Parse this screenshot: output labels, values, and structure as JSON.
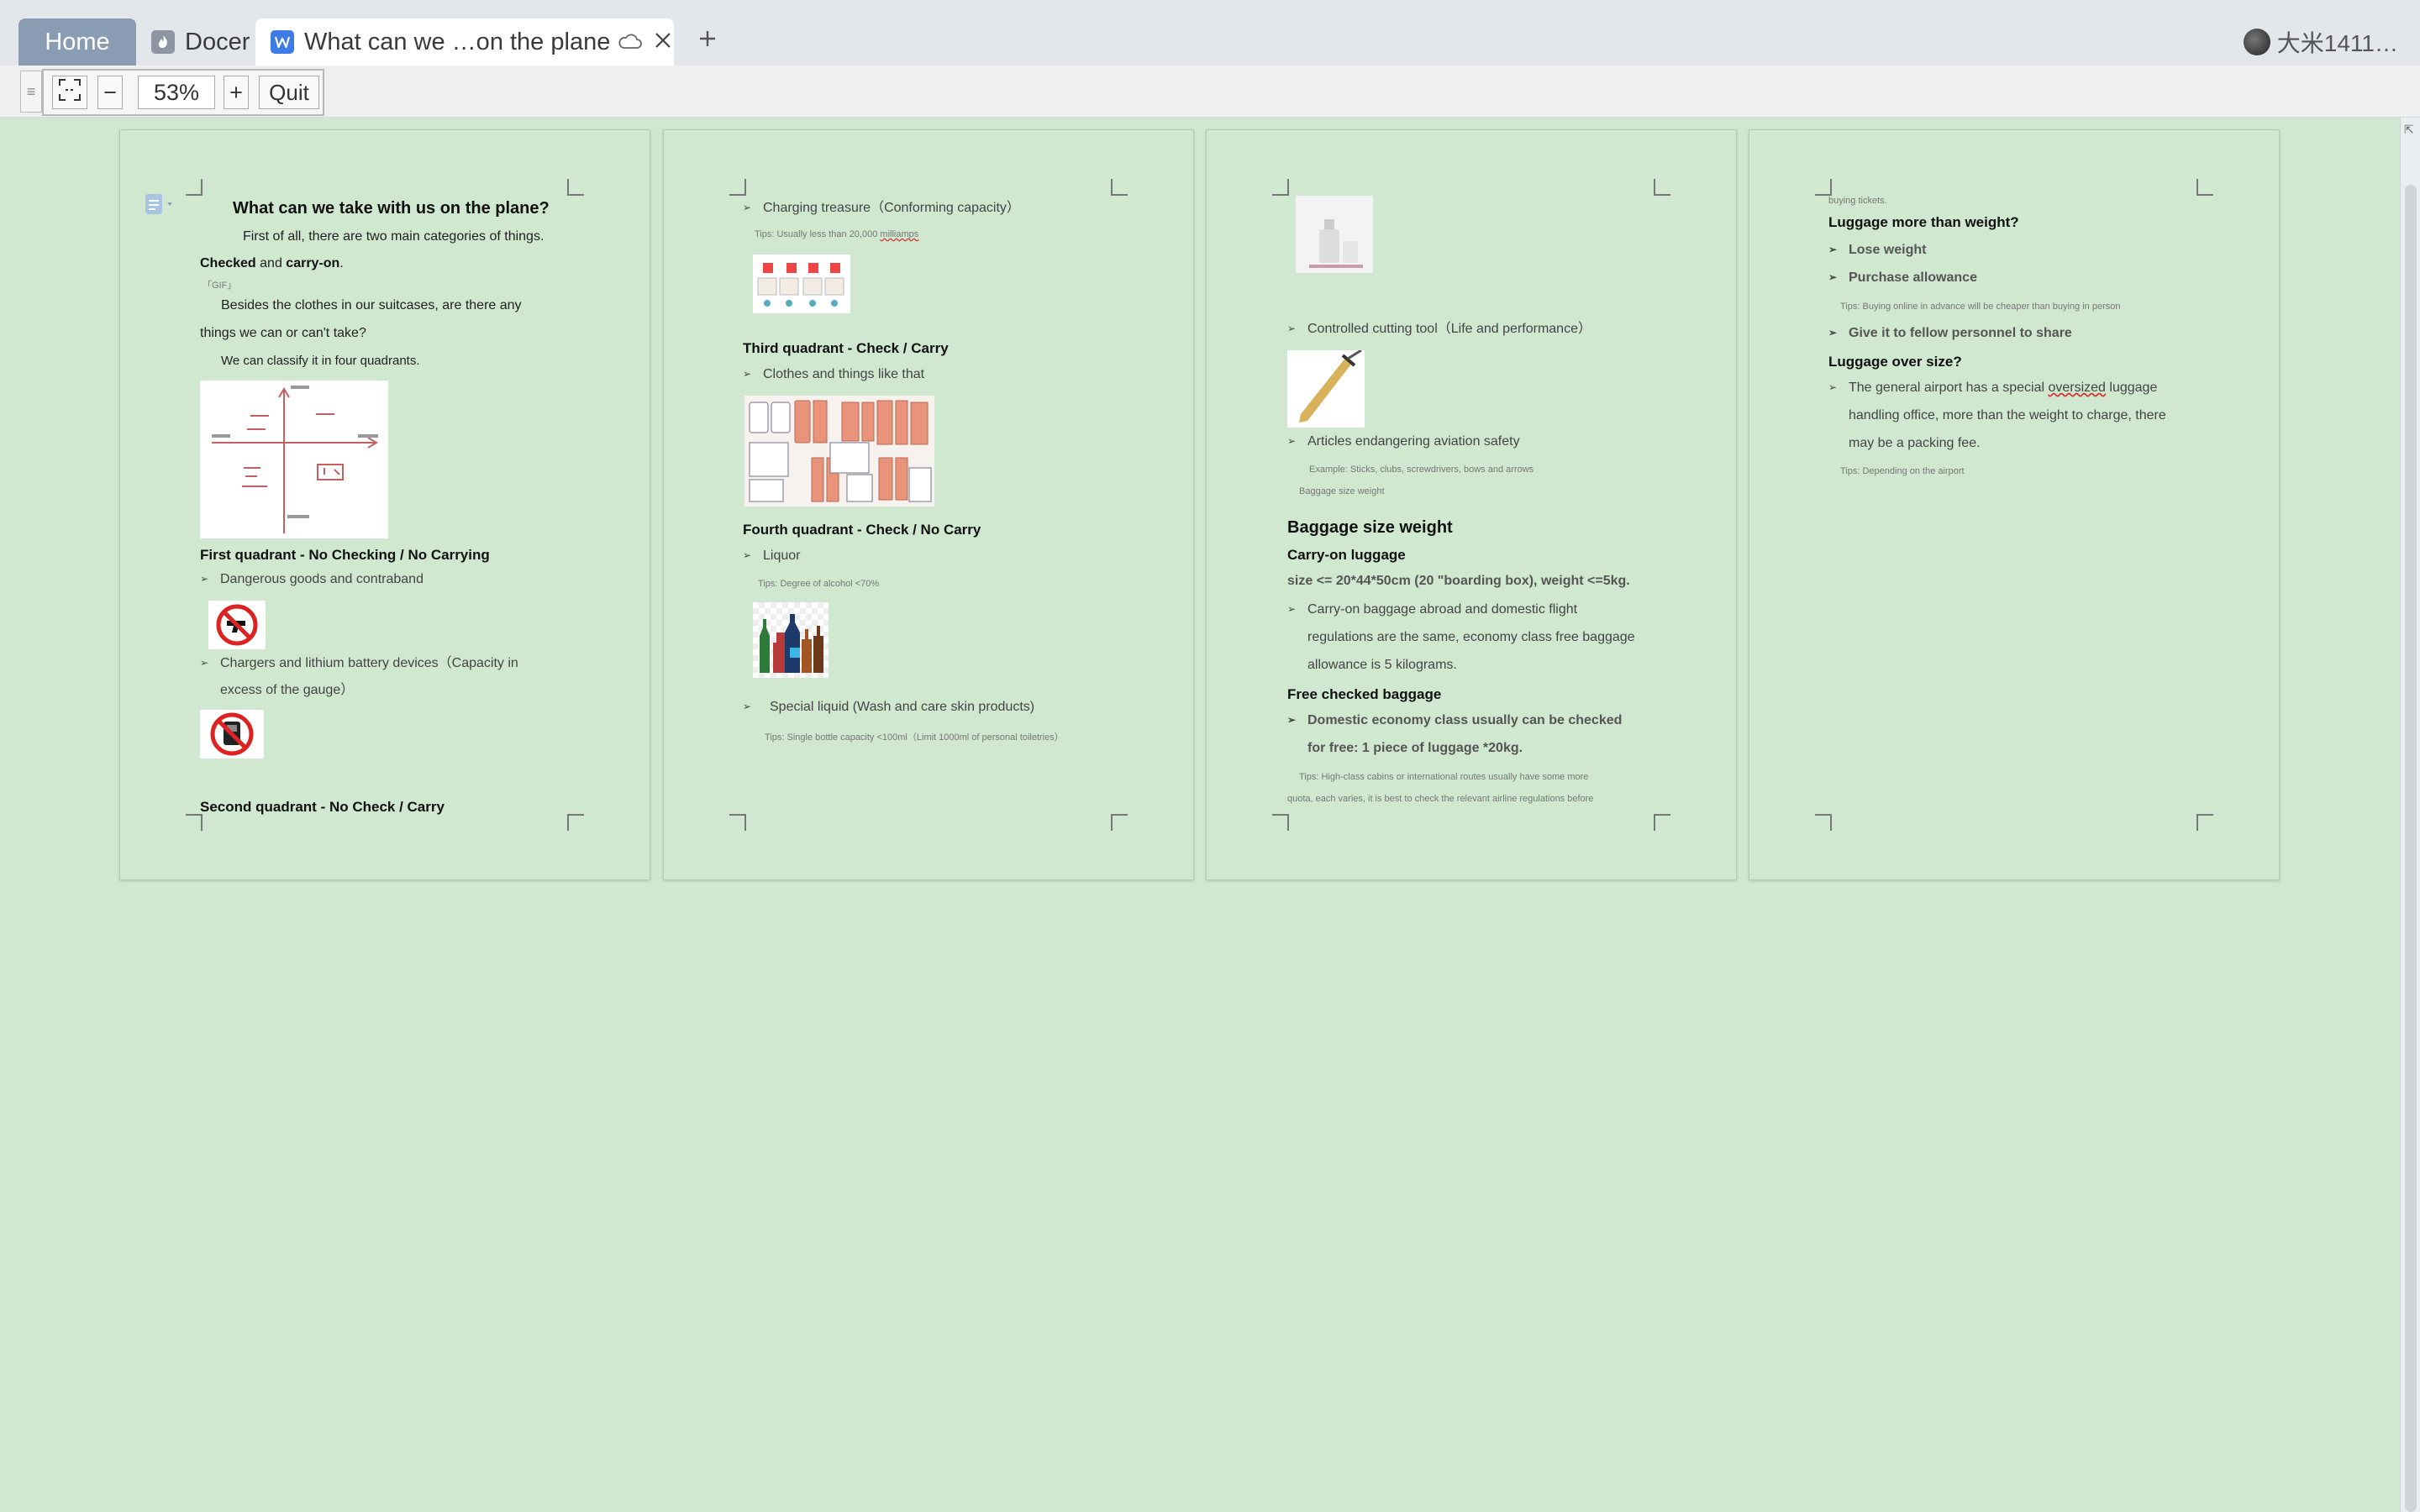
{
  "tabs": {
    "home": "Home",
    "docer": "Docer",
    "document": "What can we …on the plane"
  },
  "user": {
    "name": "大米1411…"
  },
  "toolbar": {
    "zoom": "53%",
    "quit": "Quit",
    "minus": "−",
    "plus": "+"
  },
  "page1": {
    "title": "What can we take with us on the plane?",
    "p1a": "First of all, there are two main categories of things.",
    "p1b_bold1": "Checked",
    "p1b_and": " and ",
    "p1b_bold2": "carry-on",
    "p1b_end": ".",
    "gif": "「GIF」",
    "p2a": "Besides the clothes in our suitcases, are there any",
    "p2b": "things we can or can't take?",
    "p3": "We can classify it in four quadrants.",
    "q1_title": "First quadrant - No Checking / No Carrying",
    "q1_item1": "Dangerous goods and contraband",
    "q1_item2a": "Chargers and lithium battery devices（Capacity in",
    "q1_item2b": "excess of the gauge）",
    "q2_title": "Second quadrant - No Check / Carry"
  },
  "page2": {
    "item_charging": "Charging treasure（Conforming capacity）",
    "tip_charging_a": "Tips:  Usually less than 20,000 ",
    "tip_charging_b": "milliamps",
    "q3_title": "Third quadrant - Check / Carry",
    "q3_item": "Clothes and things like that",
    "q4_title": "Fourth quadrant - Check / No Carry",
    "q4_item": "Liquor",
    "tip_liquor": "Tips:  Degree of alcohol <70%",
    "item_liquid": "Special liquid (Wash and care skin products)",
    "tip_liquid": "Tips:  Single bottle capacity <100ml（Limit 1000ml of personal toiletries）"
  },
  "page3": {
    "item_cutting": "Controlled cutting tool（Life and performance）",
    "item_safety": "Articles endangering aviation safety",
    "example": "Example:  Sticks, clubs, screwdrivers, bows and arrows",
    "small_label": "Baggage size weight",
    "heading": "Baggage size weight",
    "carryon_title": "Carry-on luggage",
    "carryon_size": "size <= 20*44*50cm (20 \"boarding box), weight <=5kg.",
    "carryon_item_a": "Carry-on baggage abroad and domestic flight",
    "carryon_item_b": "regulations are the same, economy class free baggage",
    "carryon_item_c": "allowance is 5 kilograms.",
    "free_title": "Free checked baggage",
    "free_item_a": "Domestic economy class usually can be checked",
    "free_item_b": "for free: 1 piece of luggage *20kg.",
    "tip_a": "Tips:  High-class cabins or international routes usually have some more",
    "tip_b": "quota, each varies, it is best to check the relevant airline regulations before"
  },
  "page4": {
    "top_small": "buying tickets.",
    "weight_title": "Luggage more than weight?",
    "item_lose": "Lose weight",
    "item_purchase": "Purchase allowance",
    "tip_online": "Tips:  Buying online in advance will be cheaper than buying in person",
    "item_give": "Give it to fellow personnel to share",
    "size_title": "Luggage over size?",
    "size_item_a1": "The general airport has a special ",
    "size_item_a2": "oversized",
    "size_item_a3": " luggage",
    "size_item_b": "handling office, more than the weight to charge, there",
    "size_item_c": "may be a packing fee.",
    "tip_airport": "Tips:  Depending on the airport"
  },
  "icons": {
    "docer": "docer-flame-icon",
    "doc": "writer-w-icon",
    "cloud": "cloud-icon",
    "close": "close-icon",
    "add": "plus-icon"
  },
  "colors": {
    "page": "#cfe8cf",
    "background": "#d0e7d2",
    "home_tab": "#8a9bb4",
    "accent": "#3d7be6"
  }
}
